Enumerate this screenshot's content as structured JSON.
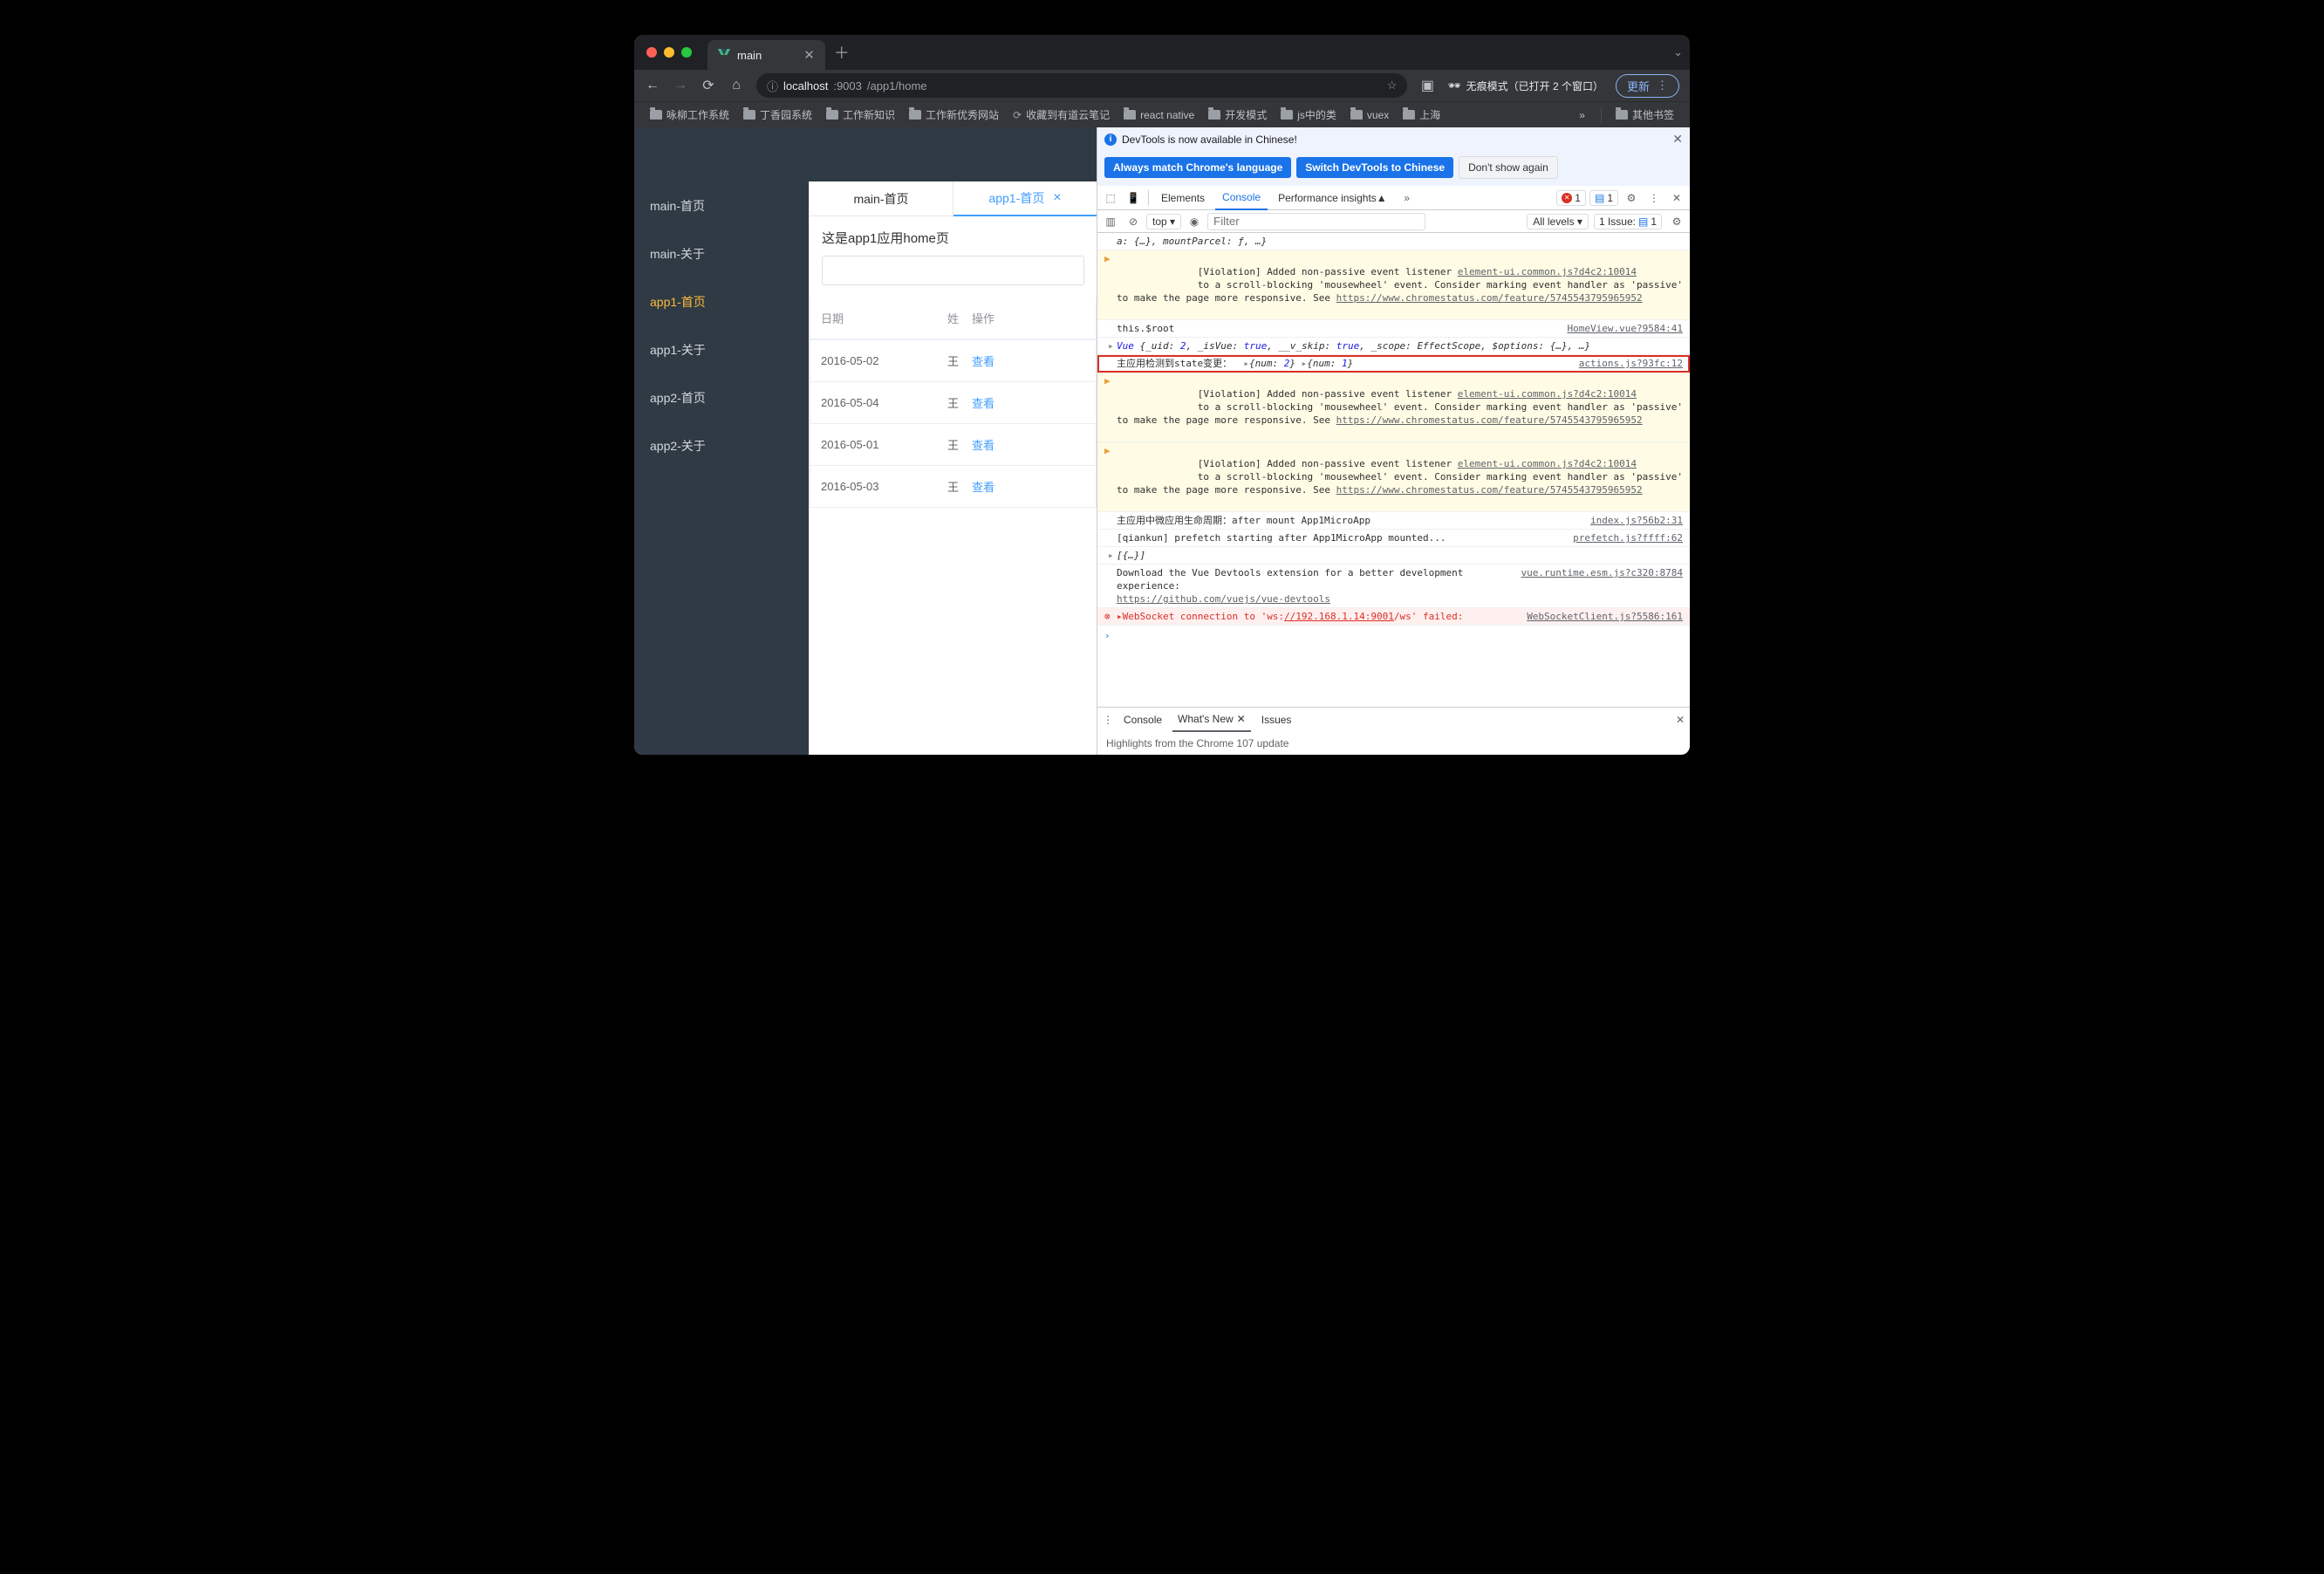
{
  "browser": {
    "tab_title": "main",
    "url_prefix": "localhost",
    "url_port": ":9003",
    "url_path": "/app1/home",
    "incognito": "无痕模式（已打开 2 个窗口）",
    "update": "更新",
    "bookmarks": [
      "咏柳工作系统",
      "丁香园系统",
      "工作新知识",
      "工作新优秀网站",
      "收藏到有道云笔记",
      "react native",
      "开发模式",
      "js中的类",
      "vuex",
      "上海"
    ],
    "bookmarks_more": "»",
    "bookmarks_other": "其他书签"
  },
  "app": {
    "sidebar": [
      "main-首页",
      "main-关于",
      "app1-首页",
      "app1-关于",
      "app2-首页",
      "app2-关于"
    ],
    "sidebar_active_index": 2,
    "tabs": [
      {
        "label": "main-首页",
        "active": false
      },
      {
        "label": "app1-首页",
        "active": true
      }
    ],
    "heading": "这是app1应用home页",
    "table": {
      "headers": [
        "日期",
        "姓",
        "操作"
      ],
      "rows": [
        {
          "date": "2016-05-02",
          "name": "王",
          "op": "查看"
        },
        {
          "date": "2016-05-04",
          "name": "王",
          "op": "查看"
        },
        {
          "date": "2016-05-01",
          "name": "王",
          "op": "查看"
        },
        {
          "date": "2016-05-03",
          "name": "王",
          "op": "查看"
        }
      ]
    }
  },
  "devtools": {
    "banner": "DevTools is now available in Chinese!",
    "chip_match": "Always match Chrome's language",
    "chip_switch": "Switch DevTools to Chinese",
    "chip_dont": "Don't show again",
    "tabs": [
      "Elements",
      "Console",
      "Performance insights"
    ],
    "active_tab_index": 1,
    "error_count": "1",
    "msg_count": "1",
    "sub": {
      "scope": "top ▾",
      "filter_ph": "Filter",
      "levels": "All levels ▾",
      "issues": "1 Issue:",
      "issues_n": "1"
    },
    "lines": {
      "l0": "a: {…}, mountParcel: ƒ, …}",
      "l1a": "[Violation] Added non-passive event listener ",
      "l1link": "element-ui.common.js?d4c2:10014",
      "l1b": "to a scroll-blocking 'mousewheel' event. Consider marking event handler as 'passive' to make the page more responsive. See ",
      "l1c": "https://www.chromestatus.com/feature/5745543795965952",
      "l2": "this.$root",
      "l2src": "HomeView.vue?9584:41",
      "l3": "Vue {_uid: 2, _isVue: true, __v_skip: true, _scope: EffectScope, $options: {…}, …}",
      "l4": "主应用检测到state变更：  ▸{num: 2} ▸{num: 1}",
      "l4src": "actions.js?93fc:12",
      "l5a": "[Violation] Added non-passive event listener ",
      "l5link": "element-ui.common.js?d4c2:10014",
      "l6a": "[Violation] Added non-passive event listener ",
      "l6link": "element-ui.common.js?d4c2:10014",
      "l7": "主应用中微应用生命周期：after mount App1MicroApp",
      "l7src": "index.js?56b2:31",
      "l8": "[qiankun] prefetch starting after App1MicroApp mounted...",
      "l8src": "prefetch.js?ffff:62",
      "l8b": "[{…}]",
      "l9a": "Download the Vue Devtools extension for a better development experience:",
      "l9src": "vue.runtime.esm.js?c320:8784",
      "l9b": "https://github.com/vuejs/vue-devtools",
      "l10a": "WebSocket connection to 'ws:",
      "l10b": "//192.168.1.14:9001",
      "l10c": "/ws' failed:",
      "l10src": "WebSocketClient.js?5586:161"
    },
    "drawer": {
      "tabs": [
        "Console",
        "What's New",
        "Issues"
      ],
      "active": 1,
      "body": "Highlights from the Chrome 107 update"
    }
  }
}
